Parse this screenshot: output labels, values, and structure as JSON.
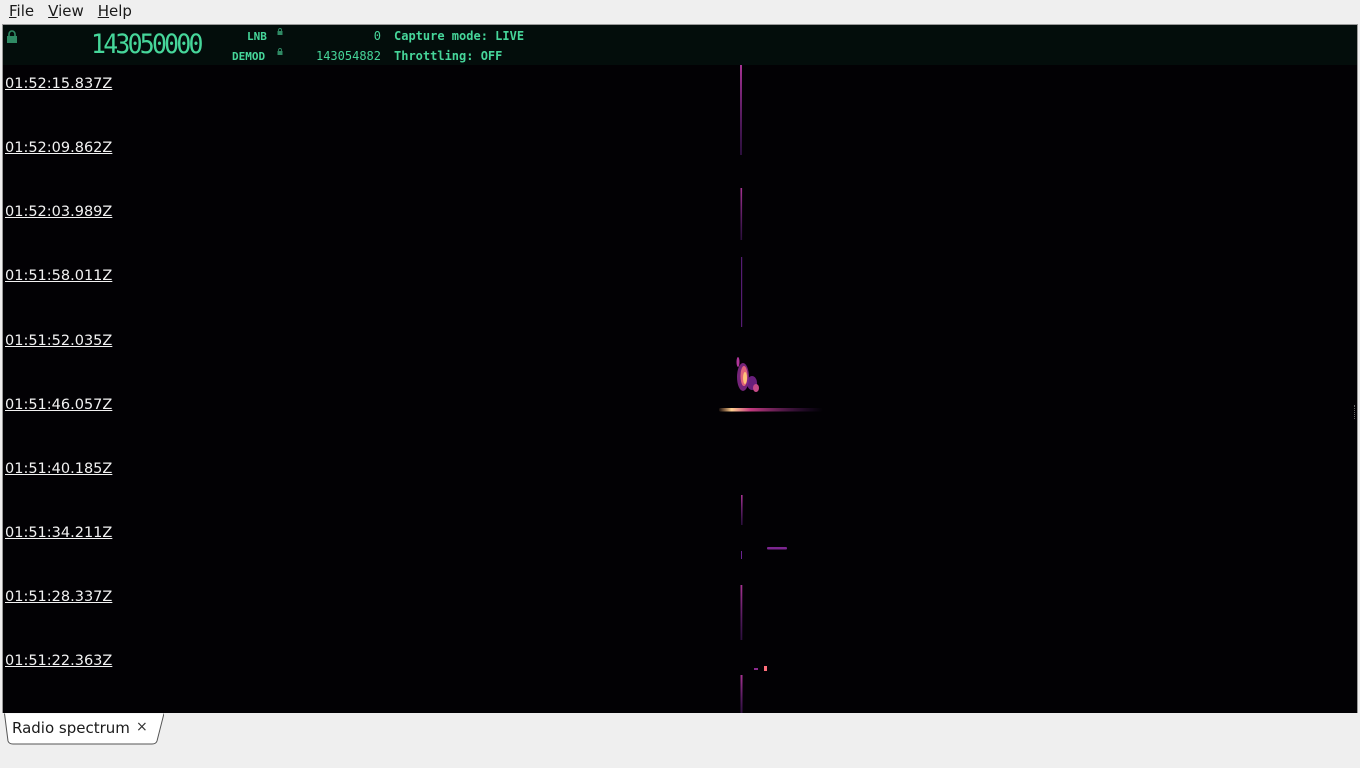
{
  "menu": [
    {
      "mnemonic": "F",
      "rest": "ile"
    },
    {
      "mnemonic": "V",
      "rest": "iew"
    },
    {
      "mnemonic": "H",
      "rest": "elp"
    }
  ],
  "status": {
    "main_frequency": "143050000",
    "lnb_label": "LNB",
    "lnb_value": "0",
    "demod_label": "DEMOD",
    "demod_value": "143054882",
    "capture_mode": "Capture mode: LIVE",
    "throttling": "Throttling: OFF"
  },
  "waterfall": {
    "timestamps": [
      "01:52:15.837Z",
      "01:52:09.862Z",
      "01:52:03.989Z",
      "01:51:58.011Z",
      "01:51:52.035Z",
      "01:51:46.057Z",
      "01:51:40.185Z",
      "01:51:34.211Z",
      "01:51:28.337Z",
      "01:51:22.363Z"
    ]
  },
  "colors": {
    "lcd_green": "#46d69a",
    "waterfall_bg": "#020104",
    "signal_magenta": "#b0359a",
    "signal_hot": "#ffb070"
  },
  "tabs": [
    {
      "label": "Radio spectrum",
      "close": "×"
    }
  ]
}
